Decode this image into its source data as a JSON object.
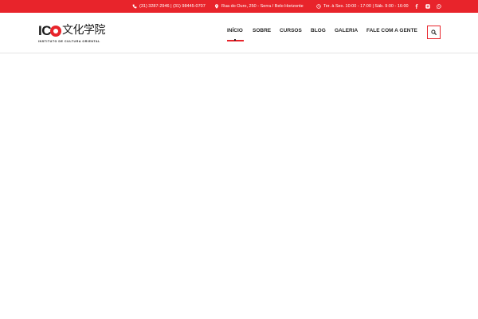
{
  "topbar": {
    "phone": "(31) 3287-2946 | (31) 98445-0707",
    "address": "Rua do Ouro, 250 - Serra / Belo Horizonte",
    "hours": "Ter. à Sex. 10:00 - 17:00 | Sáb. 9:00 - 16:00",
    "background_color": "#e8242b",
    "icons": {
      "phone": "phone-icon",
      "address": "map-marker-icon",
      "hours": "clock-icon",
      "social": [
        "facebook-icon",
        "instagram-icon",
        "whatsapp-icon"
      ]
    }
  },
  "logo": {
    "letters": "IC",
    "kanji": "文化学院",
    "subtitle": "INSTITUTO DE CULTURA ORIENTAL"
  },
  "nav": {
    "items": [
      {
        "label": "INÍCIO",
        "active": true
      },
      {
        "label": "SOBRE"
      },
      {
        "label": "CURSOS"
      },
      {
        "label": "BLOG"
      },
      {
        "label": "GALERIA"
      },
      {
        "label": "FALE COM A GENTE"
      }
    ],
    "accent_color": "#e8242b",
    "search_icon": "search-icon"
  }
}
